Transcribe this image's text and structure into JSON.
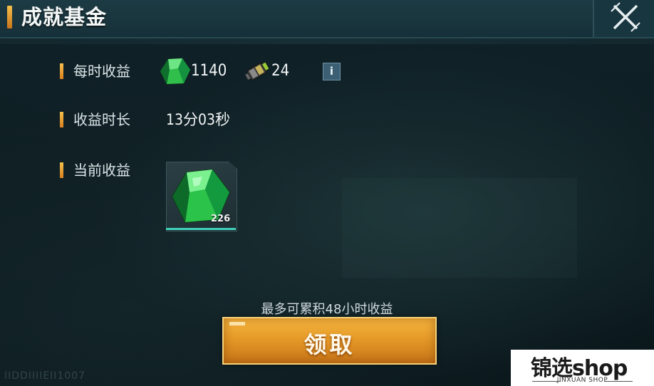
{
  "title": "成就基金",
  "rows": {
    "hourly": {
      "label": "每时收益",
      "crystal_amount": "1140",
      "fuel_amount": "24",
      "info_icon": "i"
    },
    "duration": {
      "label": "收益时长",
      "value": "13分03秒"
    },
    "current": {
      "label": "当前收益",
      "item_count": "226",
      "item_icon": "green-crystal-icon"
    }
  },
  "max_note": "最多可累积48小时收益",
  "claim_button": "领取",
  "faint_text": "IIDDIIIIEII1007",
  "shop_logo": {
    "name": "锦选shop",
    "sub": "JINXUAN SHOP"
  },
  "colors": {
    "accent": "#f0a72f",
    "crystal": "#2fbf4a",
    "bg": "#0c1a1e"
  }
}
